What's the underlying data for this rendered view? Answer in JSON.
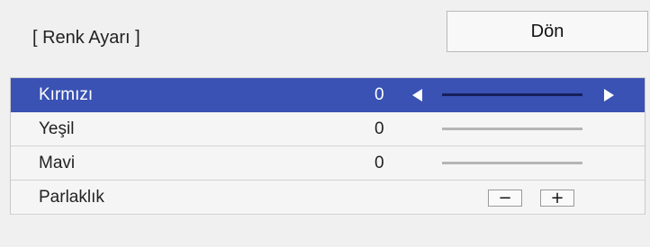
{
  "header": {
    "title": "[ Renk Ayarı ]",
    "back_label": "Dön"
  },
  "rows": [
    {
      "label": "Kırmızı",
      "value": "0",
      "selected": true
    },
    {
      "label": "Yeşil",
      "value": "0"
    },
    {
      "label": "Mavi",
      "value": "0"
    },
    {
      "label": "Parlaklık"
    }
  ],
  "brightness": {
    "minus_label": "−",
    "plus_label": "+"
  },
  "colors": {
    "selection": "#3a52b4",
    "selected_track": "#16205c",
    "background": "#f0f0f0"
  }
}
